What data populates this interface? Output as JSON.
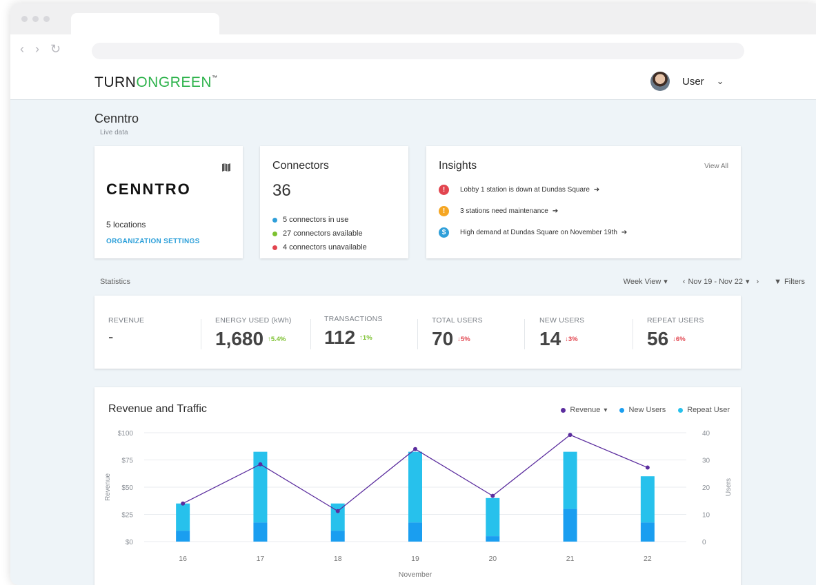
{
  "app": {
    "brand_prefix": "TURN",
    "brand_o": "O",
    "brand_suffix": "NGREEN",
    "brand_tm": "™",
    "user_name": "User"
  },
  "org": {
    "name": "Cenntro",
    "subtitle": "Live data",
    "logo_text": "CENNTRO",
    "locations": "5 locations",
    "settings_link": "ORGANIZATION SETTINGS"
  },
  "connectors": {
    "title": "Connectors",
    "count": "36",
    "items": [
      {
        "text": "5 connectors in use",
        "color": "#2f9fd9"
      },
      {
        "text": "27 connectors available",
        "color": "#7cc12f"
      },
      {
        "text": "4 connectors unavailable",
        "color": "#e2454f"
      }
    ]
  },
  "insights": {
    "title": "Insights",
    "view_all": "View All",
    "items": [
      {
        "icon": "alert-icon",
        "glyph": "!",
        "color": "#e2454f",
        "text": "Lobby 1 station is down at Dundas Square",
        "arrow": "➔"
      },
      {
        "icon": "warning-icon",
        "glyph": "!",
        "color": "#f5a623",
        "text": "3 stations need maintenance",
        "arrow": "➔"
      },
      {
        "icon": "dollar-icon",
        "glyph": "$",
        "color": "#2f9fd9",
        "text": "High demand at Dundas Square on November 19th",
        "arrow": "➔"
      }
    ]
  },
  "statistics": {
    "label": "Statistics",
    "view_select": "Week View",
    "date_range": "Nov 19 - Nov 22",
    "filters": "Filters",
    "metrics": [
      {
        "label": "REVENUE",
        "value": "-",
        "delta": "",
        "dir": ""
      },
      {
        "label": "ENERGY USED (kWh)",
        "value": "1,680",
        "delta": "↑5.4%",
        "dir": "up"
      },
      {
        "label": "TRANSACTIONS",
        "value": "112",
        "delta": "↑1%",
        "dir": "up"
      },
      {
        "label": "TOTAL USERS",
        "value": "70",
        "delta": "↓5%",
        "dir": "down"
      },
      {
        "label": "NEW USERS",
        "value": "14",
        "delta": "↓3%",
        "dir": "down"
      },
      {
        "label": "REPEAT USERS",
        "value": "56",
        "delta": "↓6%",
        "dir": "down"
      }
    ]
  },
  "chart_data": {
    "type": "bar",
    "title": "Revenue and Traffic",
    "xlabel": "November",
    "ylabel": "Revenue",
    "y2label": "Users",
    "categories": [
      "16",
      "17",
      "18",
      "19",
      "20",
      "21",
      "22"
    ],
    "ylim": [
      0,
      100
    ],
    "y_ticks": [
      "$0",
      "$25",
      "$50",
      "$75",
      "$100"
    ],
    "y2lim": [
      0,
      40
    ],
    "y2_ticks": [
      "0",
      "10",
      "20",
      "30",
      "40"
    ],
    "legend": {
      "revenue": "Revenue",
      "new_users": "New Users",
      "repeat_users": "Repeat User"
    },
    "series": [
      {
        "name": "Revenue",
        "type": "line",
        "axis": "left",
        "color": "#5b2d9e",
        "values": [
          35,
          71,
          28,
          85,
          42,
          98,
          68
        ]
      },
      {
        "name": "New Users",
        "type": "bar",
        "axis": "right",
        "color": "#1a9ef0",
        "values": [
          4,
          7,
          4,
          7,
          2,
          12,
          7
        ]
      },
      {
        "name": "Repeat User",
        "type": "bar",
        "axis": "right",
        "color": "#27c1ec",
        "values": [
          10,
          26,
          10,
          26,
          14,
          21,
          17
        ]
      }
    ],
    "grid": true,
    "legend_position": "top-right"
  }
}
